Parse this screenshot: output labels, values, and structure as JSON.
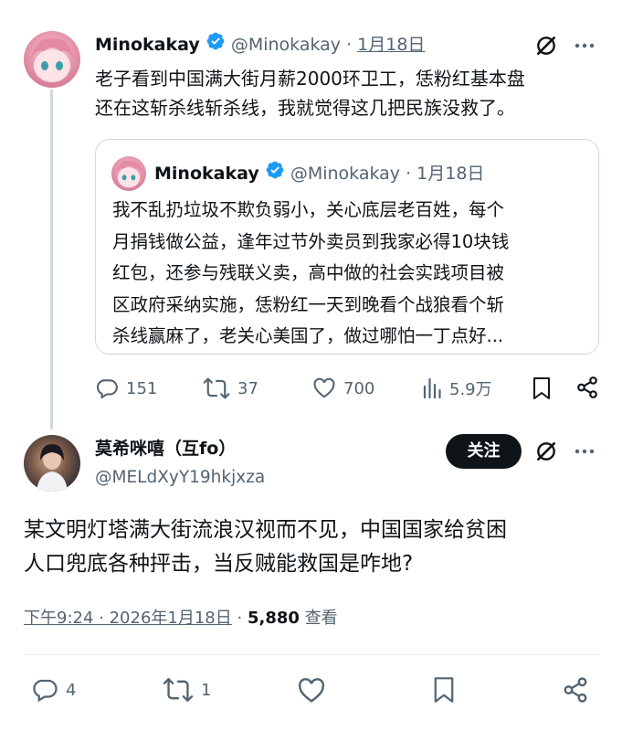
{
  "parent_tweet": {
    "display_name": "Minokakay",
    "handle": "@Minokakay",
    "separator": "·",
    "date": "1月18日",
    "text_line1": "老子看到中国满大街月薪2000环卫工，恁粉红基本盘",
    "text_line2": "还在这斩杀线斩杀线，我就觉得这几把民族没救了。",
    "quoted": {
      "display_name": "Minokakay",
      "handle": "@Minokakay",
      "separator": "·",
      "date": "1月18日",
      "lines": [
        "我不乱扔垃圾不欺负弱小，关心底层老百姓，每个",
        "月捐钱做公益，逢年过节外卖员到我家必得10块钱",
        "红包，还参与残联义卖，高中做的社会实践项目被",
        "区政府采纳实施，恁粉红一天到晚看个战狼看个斩",
        "杀线赢麻了，老关心美国了，做过哪怕一丁点好..."
      ]
    },
    "actions": {
      "replies": "151",
      "retweets": "37",
      "likes": "700",
      "views": "5.9万"
    }
  },
  "main_tweet": {
    "display_name": "莫希咪嘻（互fo）",
    "handle": "@MELdXyY19hkjxza",
    "follow_label": "关注",
    "text_line1": "某文明灯塔满大街流浪汉视而不见，中国国家给贫困",
    "text_line2": "人口兜底各种抨击，当反贼能救国是咋地?",
    "time_date": "下午9:24 · 2026年1月18日",
    "meta_separator": "·",
    "views_count": "5,880",
    "views_label": "查看",
    "actions": {
      "replies": "4",
      "retweets": "1"
    }
  },
  "colors": {
    "text": "#0f1419",
    "muted": "#536471",
    "verified": "#1d9bf0",
    "thread_line": "#cfd9de"
  }
}
